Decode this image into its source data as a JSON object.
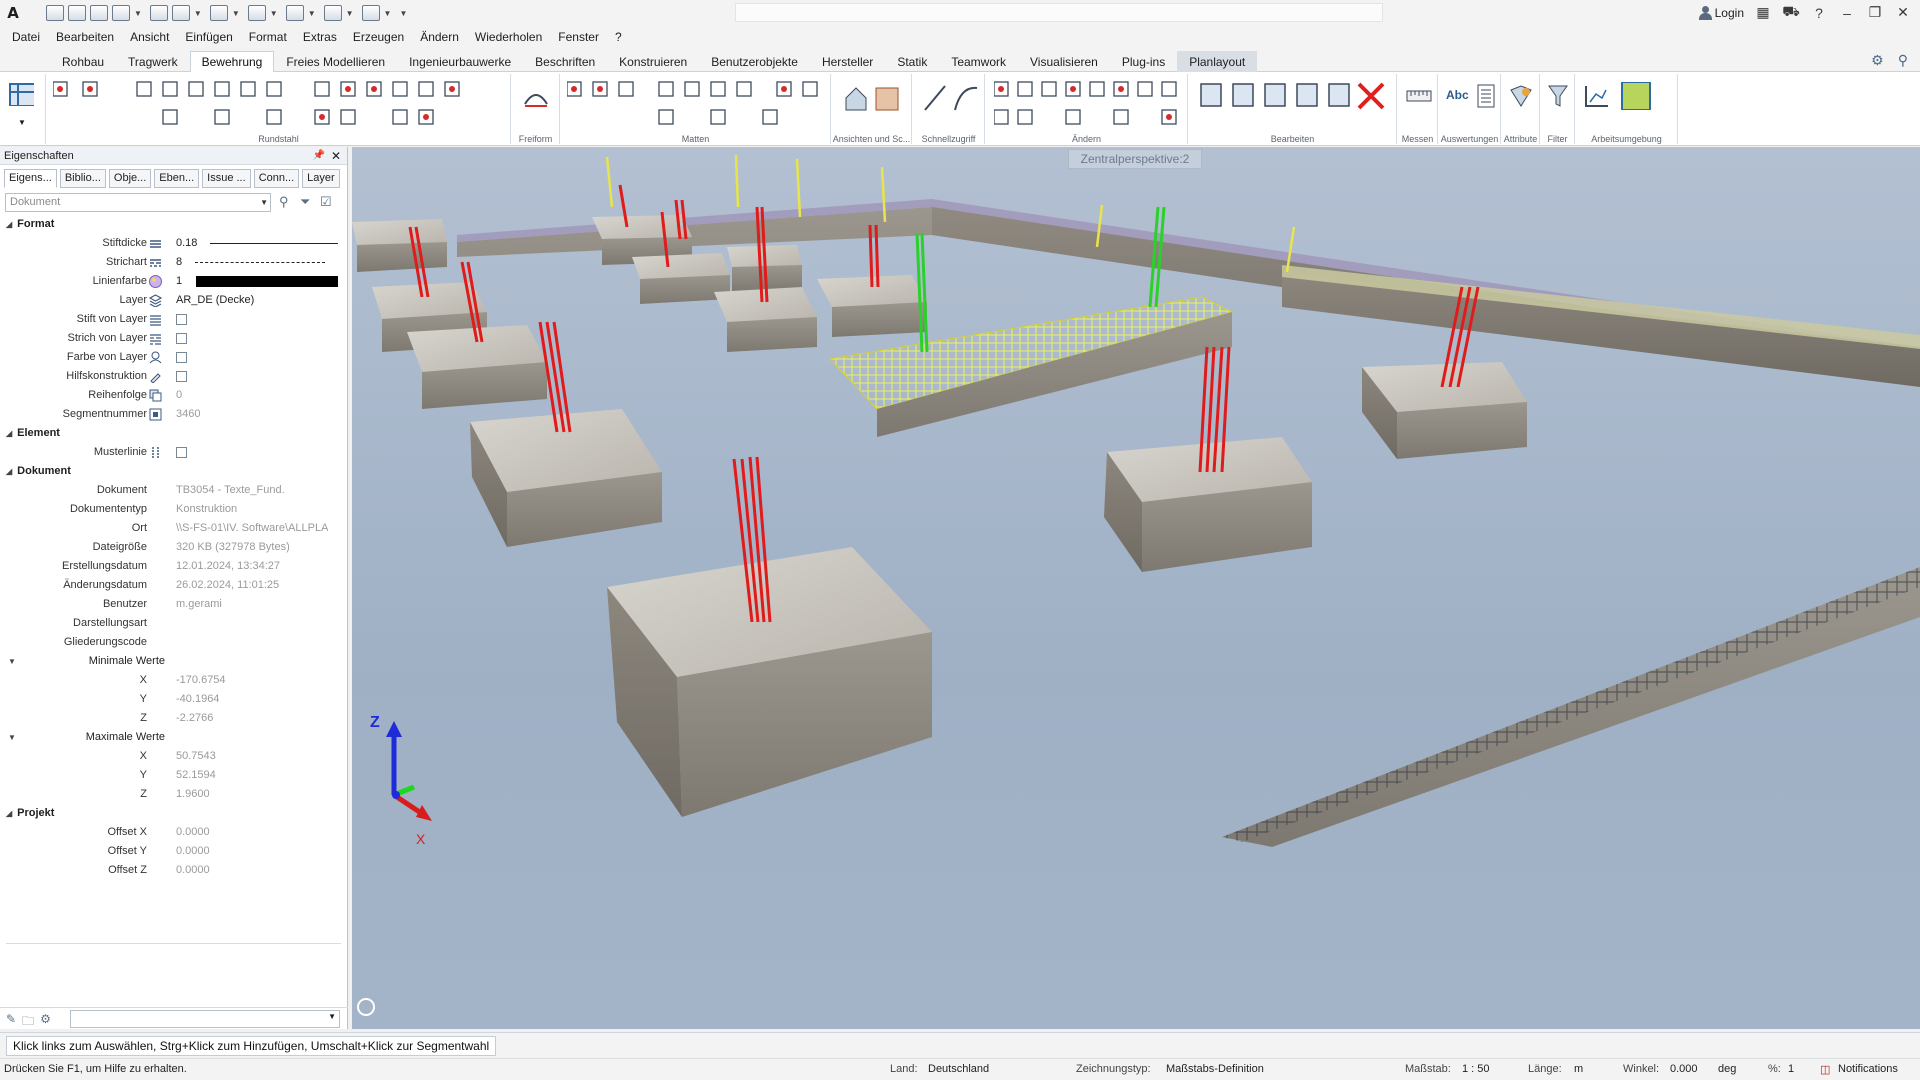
{
  "titlebar": {
    "logo": "A",
    "login": "Login"
  },
  "menu": [
    "Datei",
    "Bearbeiten",
    "Ansicht",
    "Einfügen",
    "Format",
    "Extras",
    "Erzeugen",
    "Ändern",
    "Wiederholen",
    "Fenster",
    "?"
  ],
  "tabs": [
    "Rohbau",
    "Tragwerk",
    "Bewehrung",
    "Freies Modellieren",
    "Ingenieurbauwerke",
    "Beschriften",
    "Konstruieren",
    "Benutzerobjekte",
    "Hersteller",
    "Statik",
    "Teamwork",
    "Visualisieren",
    "Plug-ins",
    "Planlayout"
  ],
  "active_tab": "Bewehrung",
  "ribbon_groups": [
    "Rundstahl",
    "Freiform",
    "Matten",
    "Ansichten und Sc...",
    "Schnellzugriff",
    "Ändern",
    "Bearbeiten",
    "Messen",
    "Auswertungen",
    "Attribute",
    "Filter",
    "Arbeitsumgebung"
  ],
  "ribbon_text_icon": "Abc",
  "panel": {
    "title": "Eigenschaften",
    "tabs": [
      "Eigens...",
      "Biblio...",
      "Obje...",
      "Eben...",
      "Issue ...",
      "Conn...",
      "Layer"
    ],
    "filter_placeholder": "Dokument",
    "sections": {
      "format": "Format",
      "element": "Element",
      "dokument": "Dokument",
      "projekt": "Projekt"
    },
    "format": {
      "stiftdicke_label": "Stiftdicke",
      "stiftdicke": "0.18",
      "strichart_label": "Strichart",
      "strichart": "8",
      "linienfarbe_label": "Linienfarbe",
      "linienfarbe": "1",
      "layer_label": "Layer",
      "layer": "AR_DE (Decke)",
      "stift_von_layer": "Stift von Layer",
      "strich_von_layer": "Strich von Layer",
      "farbe_von_layer": "Farbe von Layer",
      "hilfskonstruktion": "Hilfskonstruktion",
      "reihenfolge_label": "Reihenfolge",
      "reihenfolge": "0",
      "segmentnummer_label": "Segmentnummer",
      "segmentnummer": "3460"
    },
    "element": {
      "musterlinie": "Musterlinie"
    },
    "dokument": {
      "dokument_label": "Dokument",
      "dokument": "TB3054 - Texte_Fund.",
      "dokumententyp_label": "Dokumententyp",
      "dokumententyp": "Konstruktion",
      "ort_label": "Ort",
      "ort": "\\\\S-FS-01\\IV. Software\\ALLPLA",
      "dateigroesse_label": "Dateigröße",
      "dateigroesse": "320 KB (327978 Bytes)",
      "erstellungsdatum_label": "Erstellungsdatum",
      "erstellungsdatum": "12.01.2024, 13:34:27",
      "aenderungsdatum_label": "Änderungsdatum",
      "aenderungsdatum": "26.02.2024, 11:01:25",
      "benutzer_label": "Benutzer",
      "benutzer": "m.gerami",
      "darstellungsart_label": "Darstellungsart",
      "gliederungscode_label": "Gliederungscode",
      "min_label": "Minimale Werte",
      "min_x": "-170.6754",
      "min_y": "-40.1964",
      "min_z": "-2.2766",
      "max_label": "Maximale Werte",
      "max_x": "50.7543",
      "max_y": "52.1594",
      "max_z": "1.9600"
    },
    "projekt": {
      "offset_x_label": "Offset X",
      "offset_x": "0.0000",
      "offset_y_label": "Offset Y",
      "offset_y": "0.0000",
      "offset_z_label": "Offset Z",
      "offset_z": "0.0000"
    },
    "axis_x": "X",
    "axis_y": "Y",
    "axis_z": "Z"
  },
  "viewport": {
    "label": "Zentralperspektive:2",
    "axis_z": "Z",
    "axis_x": "X"
  },
  "command_hint": "Klick links zum Auswählen, Strg+Klick zum Hinzufügen, Umschalt+Klick zur Segmentwahl",
  "status": {
    "help": "Drücken Sie F1, um Hilfe zu erhalten.",
    "land_label": "Land:",
    "land": "Deutschland",
    "zeichnungstyp_label": "Zeichnungstyp:",
    "zeichnungstyp": "Maßstabs-Definition",
    "massstab_label": "Maßstab:",
    "massstab": "1 : 50",
    "laenge_label": "Länge:",
    "laenge": "m",
    "winkel_label": "Winkel:",
    "winkel": "0.000",
    "winkel_unit": "deg",
    "prozent_label": "%:",
    "prozent": "1",
    "notifications": "Notifications"
  }
}
